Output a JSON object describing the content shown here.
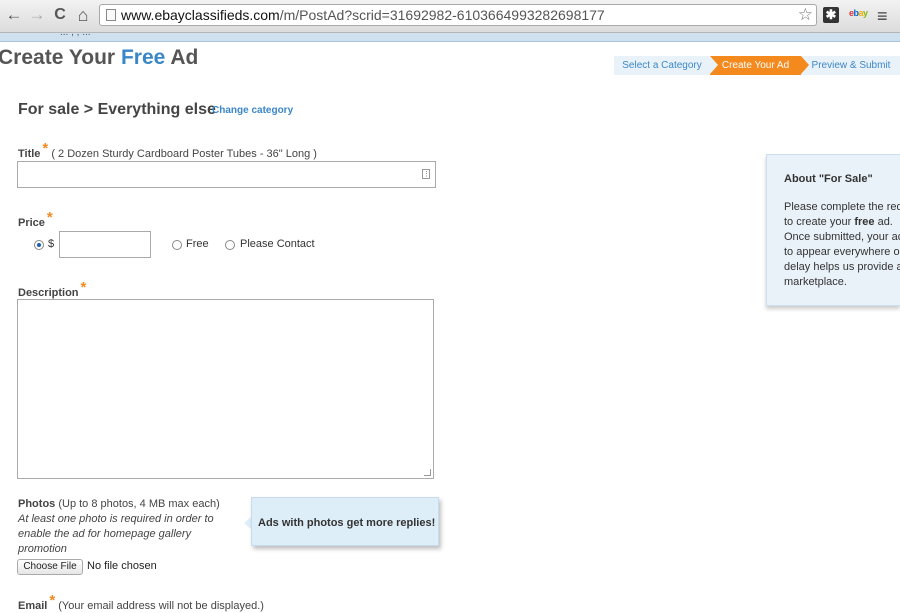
{
  "browser": {
    "url_domain": "www.ebayclassifieds.com",
    "url_path": "/m/PostAd?scrid=31692982-6103664993282698177",
    "back_icon": "←",
    "forward_icon": "→",
    "reload_icon": "C",
    "home_icon": "⌂",
    "star_icon": "☆",
    "ext_icon": "✱",
    "ext2_e": "e",
    "ext2_b": "b",
    "ext2_a": "a",
    "ext2_y": "y",
    "menu_icon": "≡"
  },
  "header": {
    "title_pre": "Create Your ",
    "title_free": "Free",
    "title_post": " Ad",
    "strip_ghost": "... , , ..."
  },
  "steps": [
    "Select a Category",
    "Create Your Ad",
    "Preview & Submit"
  ],
  "category": {
    "path": "For sale > Everything else",
    "change_link": "Change category"
  },
  "form": {
    "title_label": "Title",
    "title_hint": "( 2 Dozen Sturdy Cardboard Poster Tubes - 36\" Long )",
    "title_value": "",
    "required_mark": "*",
    "price_label": "Price",
    "price_currency": "$",
    "price_value": "",
    "price_free": "Free",
    "price_contact": "Please Contact",
    "desc_label": "Description",
    "desc_value": "",
    "photos_label": "Photos",
    "photos_hint": "(Up to 8 photos, 4 MB max each)",
    "photos_note": "At least one photo is required in order to enable the ad for homepage gallery promotion",
    "choose_file": "Choose File",
    "file_status": "No file chosen",
    "photos_tip": "Ads with photos get more replies!",
    "email_label": "Email",
    "email_hint": "(Your email address will not be displayed.)",
    "field_icon": "⋮"
  },
  "about": {
    "title": "About \"For Sale\"",
    "line1": "Please complete the requ",
    "line2_pre": "to create your ",
    "line2_bold": "free",
    "line2_post": " ad.",
    "line3": "Once submitted, your ad",
    "line4": "to appear everywhere on",
    "line5": "delay helps us provide a",
    "line6": "marketplace."
  }
}
